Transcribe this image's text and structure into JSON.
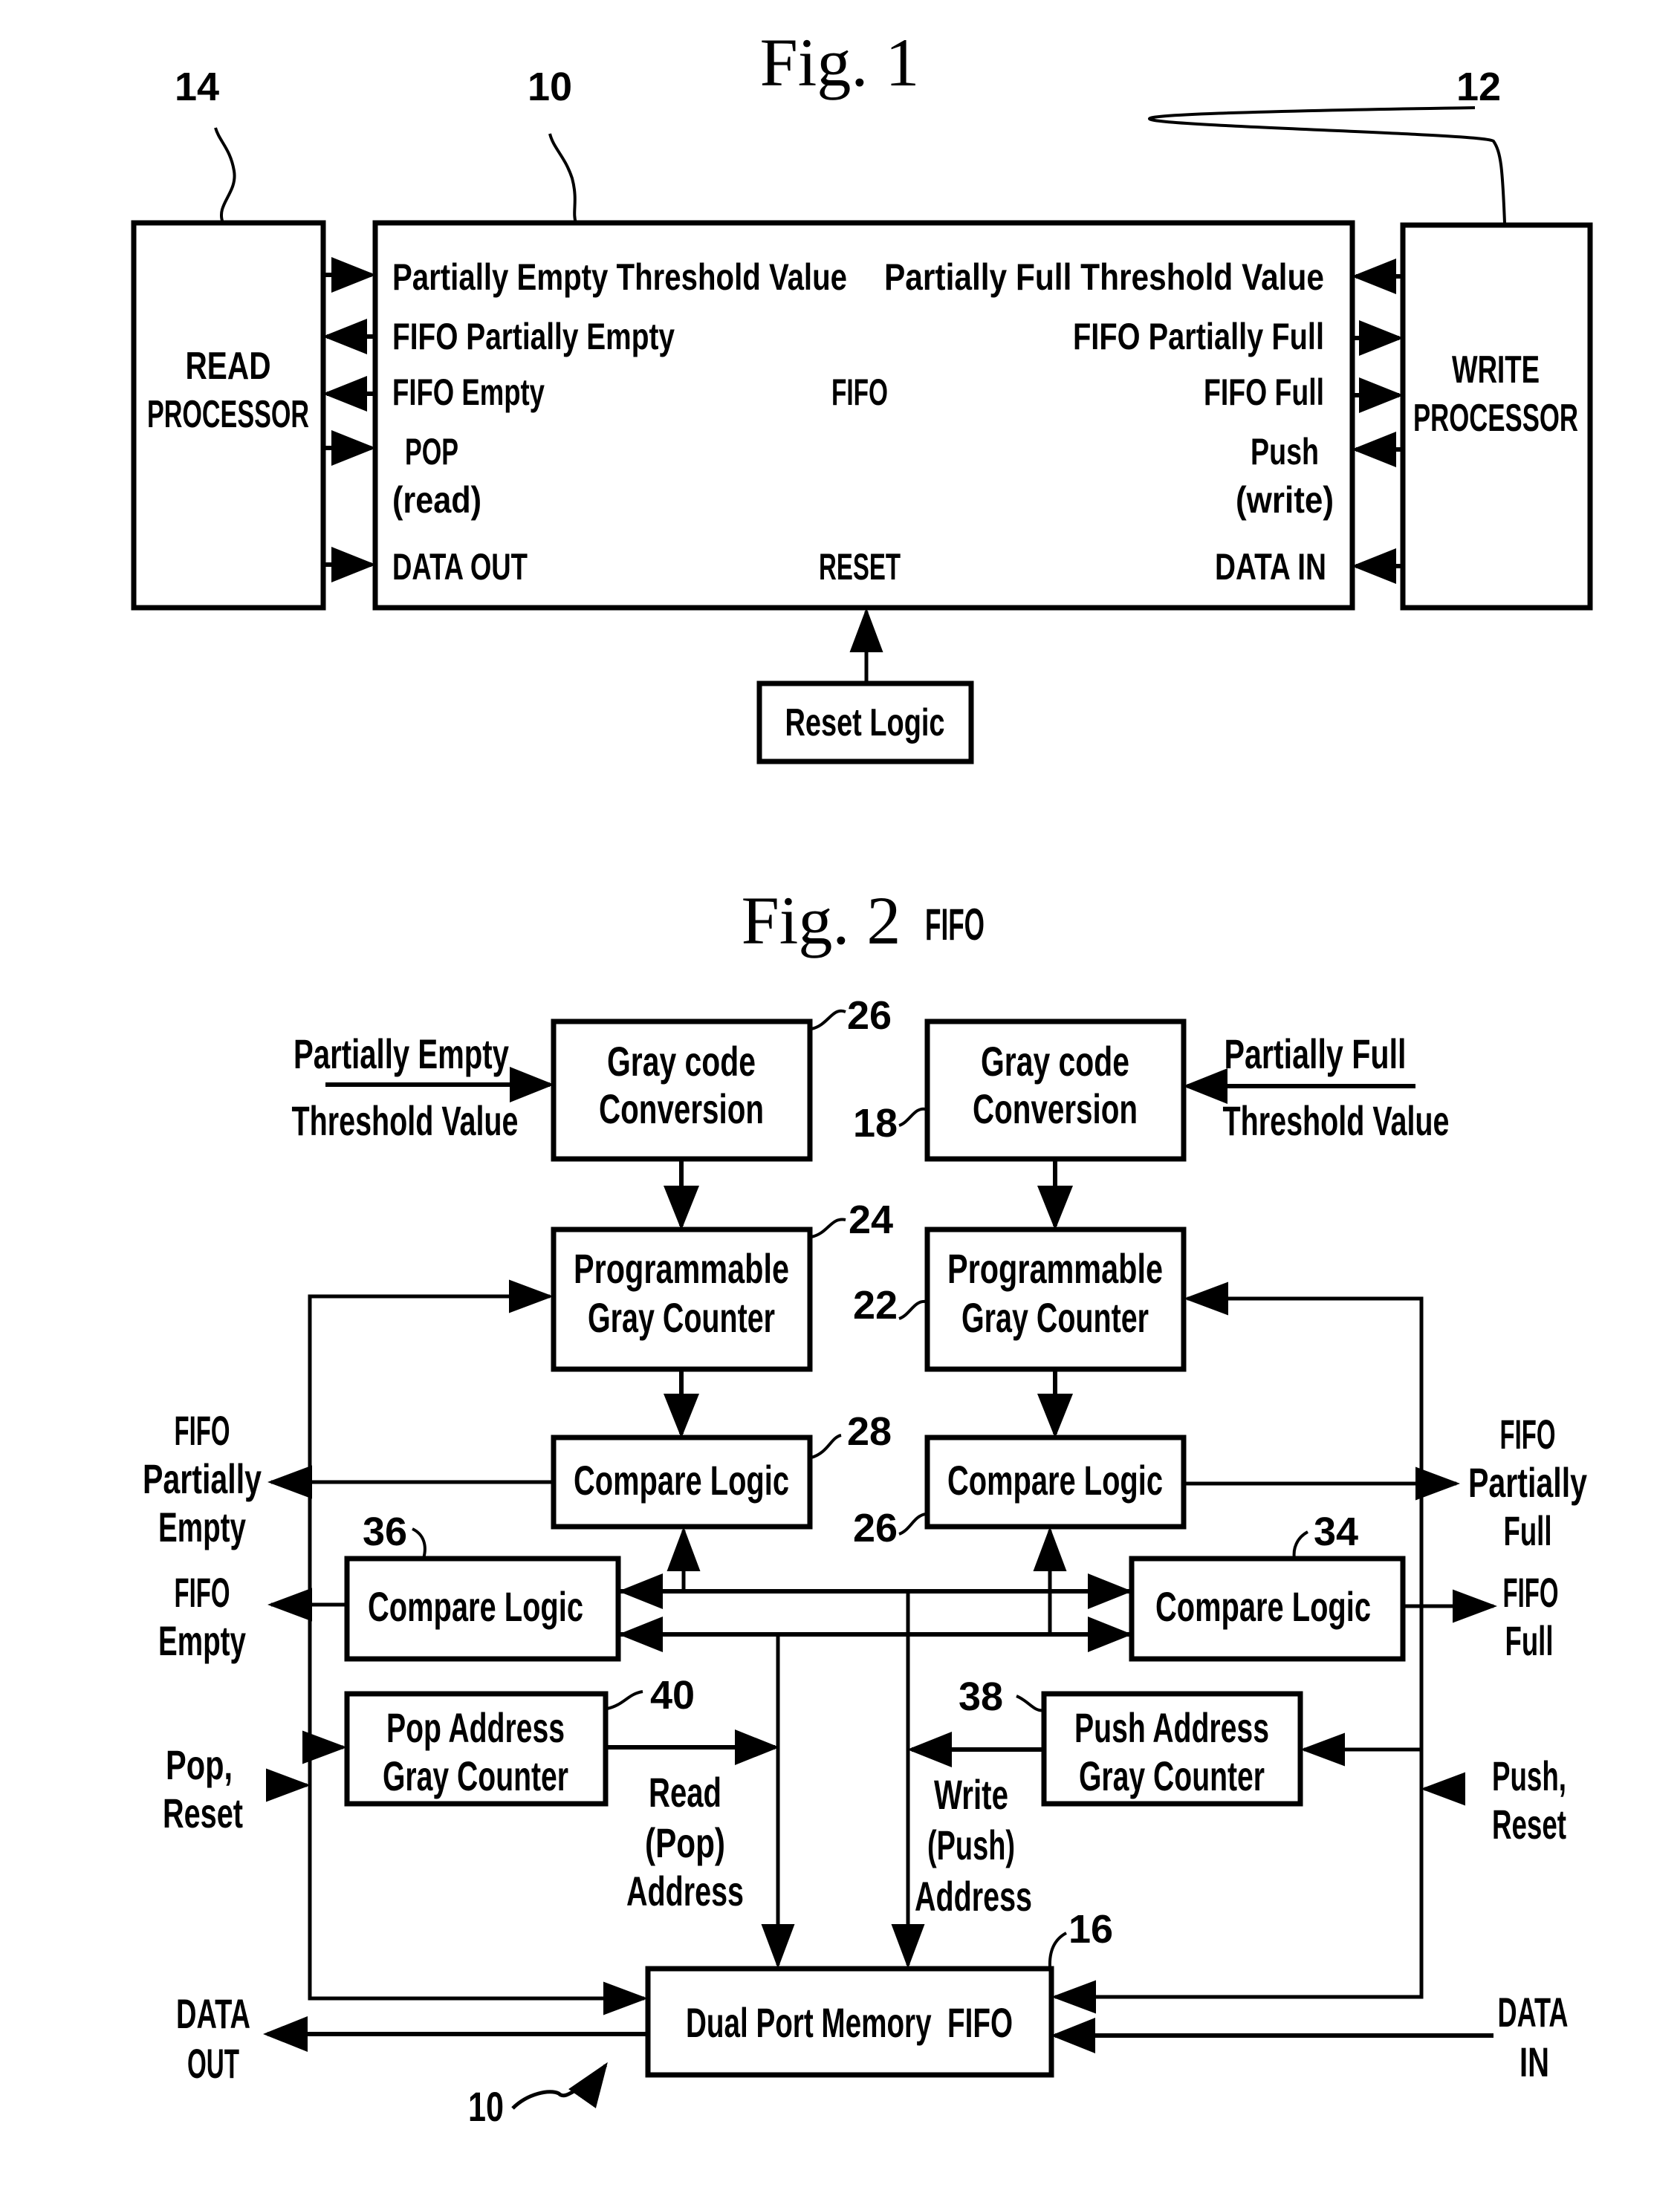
{
  "fig1": {
    "title": "Fig. 1",
    "refs": {
      "read_processor": "14",
      "fifo": "10",
      "write_processor": "12"
    },
    "read_processor": {
      "line1": "READ",
      "line2": "PROCESSOR"
    },
    "write_processor": {
      "line1": "WRITE",
      "line2": "PROCESSOR"
    },
    "fifo": {
      "center_label": "FIFO",
      "reset_label": "RESET",
      "left_signals": [
        {
          "text": "Partially Empty Threshold Value",
          "direction": "in"
        },
        {
          "text": "FIFO Partially Empty",
          "direction": "out"
        },
        {
          "text": "FIFO Empty",
          "direction": "out"
        },
        {
          "text": "POP",
          "sub": "(read)",
          "direction": "in"
        },
        {
          "text": "DATA OUT",
          "direction": "in"
        }
      ],
      "right_signals": [
        {
          "text": "Partially Full Threshold Value",
          "direction": "in"
        },
        {
          "text": "FIFO Partially Full",
          "direction": "out"
        },
        {
          "text": "FIFO Full",
          "direction": "out"
        },
        {
          "text": "Push",
          "sub": "(write)",
          "direction": "in"
        },
        {
          "text": "DATA IN",
          "direction": "in"
        }
      ]
    },
    "reset_logic": "Reset Logic"
  },
  "fig2": {
    "title": "Fig. 2",
    "title_suffix": "FIFO",
    "blocks": {
      "gray_conv_left": {
        "line1": "Gray code",
        "line2": "Conversion",
        "ref": "26"
      },
      "gray_conv_right": {
        "line1": "Gray code",
        "line2": "Conversion",
        "ref": "18"
      },
      "prog_counter_left": {
        "line1": "Programmable",
        "line2": "Gray Counter",
        "ref": "24"
      },
      "prog_counter_right": {
        "line1": "Programmable",
        "line2": "Gray Counter",
        "ref": "22"
      },
      "compare_pe": {
        "line1": "Compare Logic",
        "ref": "28"
      },
      "compare_pf": {
        "line1": "Compare Logic",
        "ref": "26"
      },
      "compare_empty": {
        "line1": "Compare Logic",
        "ref": "36"
      },
      "compare_full": {
        "line1": "Compare Logic",
        "ref": "34"
      },
      "pop_counter": {
        "line1": "Pop Address",
        "line2": "Gray Counter",
        "ref": "40"
      },
      "push_counter": {
        "line1": "Push Address",
        "line2": "Gray Counter",
        "ref": "38"
      },
      "memory": {
        "line1": "Dual Port Memory  FIFO",
        "ref": "16"
      }
    },
    "labels": {
      "pe_threshold": [
        "Partially Empty",
        "Threshold Value"
      ],
      "pf_threshold": [
        "Partially Full",
        "Threshold Value"
      ],
      "fifo_partially_empty": [
        "FIFO",
        "Partially",
        "Empty"
      ],
      "fifo_empty": [
        "FIFO",
        "Empty"
      ],
      "fifo_partially_full": [
        "FIFO",
        "Partially",
        "Full"
      ],
      "fifo_full": [
        "FIFO",
        "Full"
      ],
      "pop_reset": [
        "Pop,",
        "Reset"
      ],
      "push_reset": [
        "Push,",
        "Reset"
      ],
      "read_address": [
        "Read",
        "(Pop)",
        "Address"
      ],
      "write_address": [
        "Write",
        "(Push)",
        "Address"
      ],
      "data_out": [
        "DATA",
        "OUT"
      ],
      "data_in": [
        "DATA",
        "IN"
      ],
      "overall_ref": "10"
    }
  }
}
